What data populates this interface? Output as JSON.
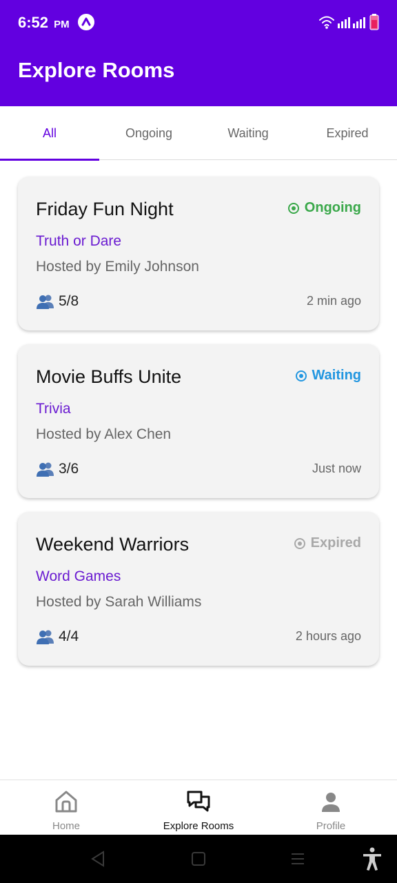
{
  "status_bar": {
    "time": "6:52",
    "ampm": "PM"
  },
  "header": {
    "title": "Explore Rooms"
  },
  "tabs": [
    {
      "label": "All",
      "active": true
    },
    {
      "label": "Ongoing",
      "active": false
    },
    {
      "label": "Waiting",
      "active": false
    },
    {
      "label": "Expired",
      "active": false
    }
  ],
  "rooms": [
    {
      "title": "Friday Fun Night",
      "status": "Ongoing",
      "status_color": "#3aa84a",
      "game": "Truth or Dare",
      "host": "Hosted by Emily Johnson",
      "players": "5/8",
      "time": "2 min ago"
    },
    {
      "title": "Movie Buffs Unite",
      "status": "Waiting",
      "status_color": "#2196e0",
      "game": "Trivia",
      "host": "Hosted by Alex Chen",
      "players": "3/6",
      "time": "Just now"
    },
    {
      "title": "Weekend Warriors",
      "status": "Expired",
      "status_color": "#a8a8a8",
      "game": "Word Games",
      "host": "Hosted by Sarah Williams",
      "players": "4/4",
      "time": "2 hours ago"
    }
  ],
  "bottom_nav": [
    {
      "label": "Home",
      "icon": "home-icon",
      "active": false
    },
    {
      "label": "Explore Rooms",
      "icon": "chat-bubbles-icon",
      "active": true
    },
    {
      "label": "Profile",
      "icon": "person-icon",
      "active": false
    }
  ],
  "colors": {
    "primary": "#6200e0",
    "game_label": "#6a1bd1"
  }
}
